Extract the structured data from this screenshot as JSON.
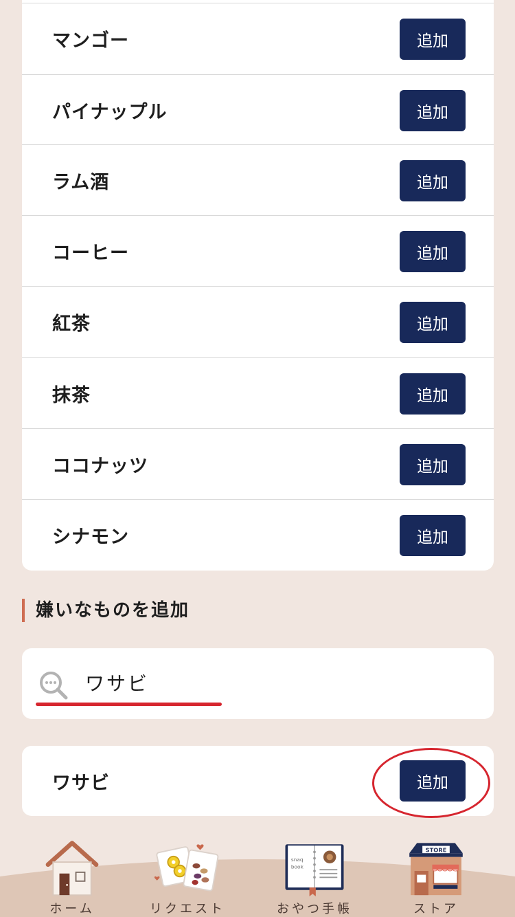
{
  "flavor_list": {
    "items": [
      {
        "label": "マンゴー",
        "button": "追加"
      },
      {
        "label": "パイナップル",
        "button": "追加"
      },
      {
        "label": "ラム酒",
        "button": "追加"
      },
      {
        "label": "コーヒー",
        "button": "追加"
      },
      {
        "label": "紅茶",
        "button": "追加"
      },
      {
        "label": "抹茶",
        "button": "追加"
      },
      {
        "label": "ココナッツ",
        "button": "追加"
      },
      {
        "label": "シナモン",
        "button": "追加"
      }
    ]
  },
  "dislike_section": {
    "heading": "嫌いなものを追加",
    "search_value": "ワサビ",
    "result": {
      "label": "ワサビ",
      "button": "追加"
    }
  },
  "bottom_nav": {
    "items": [
      {
        "label": "ホーム",
        "icon": "house-icon"
      },
      {
        "label": "リクエスト",
        "icon": "snack-cards-icon"
      },
      {
        "label": "おやつ手帳",
        "icon": "snack-book-icon"
      },
      {
        "label": "ストア",
        "icon": "store-icon"
      }
    ],
    "book_icon_text": [
      "snaq",
      "book"
    ],
    "store_icon_text": "STORE"
  },
  "colors": {
    "background": "#f1e6e0",
    "button": "#18295a",
    "accent_bar": "#cf6d52",
    "annotation_red": "#d6262f"
  }
}
